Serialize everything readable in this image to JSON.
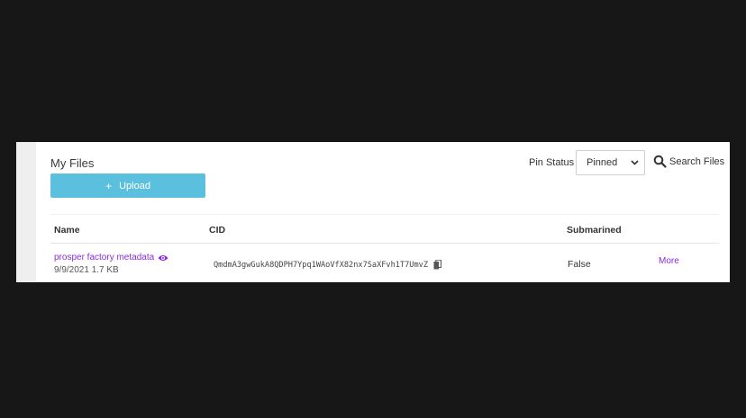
{
  "header": {
    "title": "My Files",
    "upload_label": "Upload",
    "pin_status_label": "Pin Status",
    "pin_status_value": "Pinned",
    "search_label": "Search Files"
  },
  "table": {
    "columns": [
      "Name",
      "CID",
      "Submarined"
    ],
    "rows": [
      {
        "name": "prosper factory metadata",
        "meta": "9/9/2021 1.7 KB",
        "cid": "QmdmA3gwGukA8QDPH7Ypq1WAoVfX82nx7SaXFvh1T7UmvZ",
        "submarined": "False",
        "action": "More"
      }
    ]
  },
  "colors": {
    "accent": "#8a2be2",
    "upload_button": "#5bbfde",
    "background": "#171717"
  },
  "icons": {
    "plus": "plus-icon",
    "chevron": "chevron-down-icon",
    "search": "search-icon",
    "preview": "eye-icon",
    "copy": "copy-icon"
  }
}
